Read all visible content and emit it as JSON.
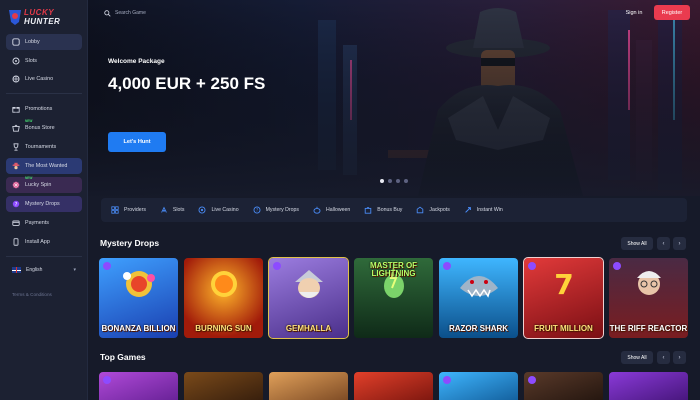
{
  "brand": {
    "line1": "LUCKY",
    "line2": "HUNTER"
  },
  "search": {
    "placeholder": "Search Game"
  },
  "auth": {
    "signin": "Sign in",
    "register": "Register"
  },
  "sidebar": {
    "items": [
      {
        "label": "Lobby",
        "icon": "lobby-icon"
      },
      {
        "label": "Slots",
        "icon": "slots-icon"
      },
      {
        "label": "Live Casino",
        "icon": "live-casino-icon"
      },
      {
        "label": "Promotions",
        "icon": "promotions-icon"
      },
      {
        "label": "Bonus Store",
        "icon": "bonus-store-icon",
        "badge": "NEW"
      },
      {
        "label": "Tournaments",
        "icon": "trophy-icon"
      },
      {
        "label": "The Most Wanted",
        "icon": "wanted-icon"
      },
      {
        "label": "Lucky Spin",
        "icon": "spin-icon",
        "badge": "NEW"
      },
      {
        "label": "Mystery Drops",
        "icon": "mystery-drops-icon"
      },
      {
        "label": "Payments",
        "icon": "payments-icon"
      },
      {
        "label": "Install App",
        "icon": "install-app-icon"
      }
    ],
    "language": "English",
    "terms": "Terms & Conditions"
  },
  "hero": {
    "subtitle": "Welcome Package",
    "title": "4,000 EUR + 250 FS",
    "cta": "Let's Hunt"
  },
  "categories": [
    {
      "label": "Providers",
      "icon": "providers-icon"
    },
    {
      "label": "Slots",
      "icon": "slots-icon"
    },
    {
      "label": "Live Casino",
      "icon": "live-casino-icon"
    },
    {
      "label": "Mystery Drops",
      "icon": "mystery-drops-icon"
    },
    {
      "label": "Halloween",
      "icon": "halloween-icon"
    },
    {
      "label": "Bonus Buy",
      "icon": "bonus-buy-icon"
    },
    {
      "label": "Jackpots",
      "icon": "jackpots-icon"
    },
    {
      "label": "Instant Win",
      "icon": "instant-win-icon"
    }
  ],
  "sections": {
    "mystery": {
      "title": "Mystery Drops",
      "show_all": "Show All",
      "games": [
        {
          "name": "BONANZA BILLION",
          "sub": "X-mas Edition",
          "bg": "#1f6fe0"
        },
        {
          "name": "BURNING SUN",
          "sub": "",
          "bg": "#a11b0a"
        },
        {
          "name": "GEMHALLA",
          "sub": "",
          "bg": "#7a55c9"
        },
        {
          "name": "MASTER OF LIGHTNING",
          "sub": "",
          "bg": "#1f5a3a"
        },
        {
          "name": "RAZOR SHARK",
          "sub": "",
          "bg": "#1a83c2"
        },
        {
          "name": "FRUIT MILLION",
          "sub": "X-mas Edition",
          "bg": "#c41f26"
        },
        {
          "name": "THE RIFF REACTOR",
          "sub": "Dr. Rock &",
          "bg": "#7a1d20"
        }
      ]
    },
    "top": {
      "title": "Top Games",
      "show_all": "Show All",
      "games": [
        {
          "bg": "#8a2fb6"
        },
        {
          "bg": "#4a2a10"
        },
        {
          "bg": "#2a4d8a"
        },
        {
          "bg": "#a11b0a"
        },
        {
          "bg": "#1a7fb6"
        },
        {
          "bg": "#2f1e14"
        },
        {
          "bg": "#6a2aa0"
        }
      ]
    }
  },
  "colors": {
    "accent_red": "#ea3b4f",
    "accent_blue": "#1f7bf2",
    "bg": "#161a29"
  }
}
